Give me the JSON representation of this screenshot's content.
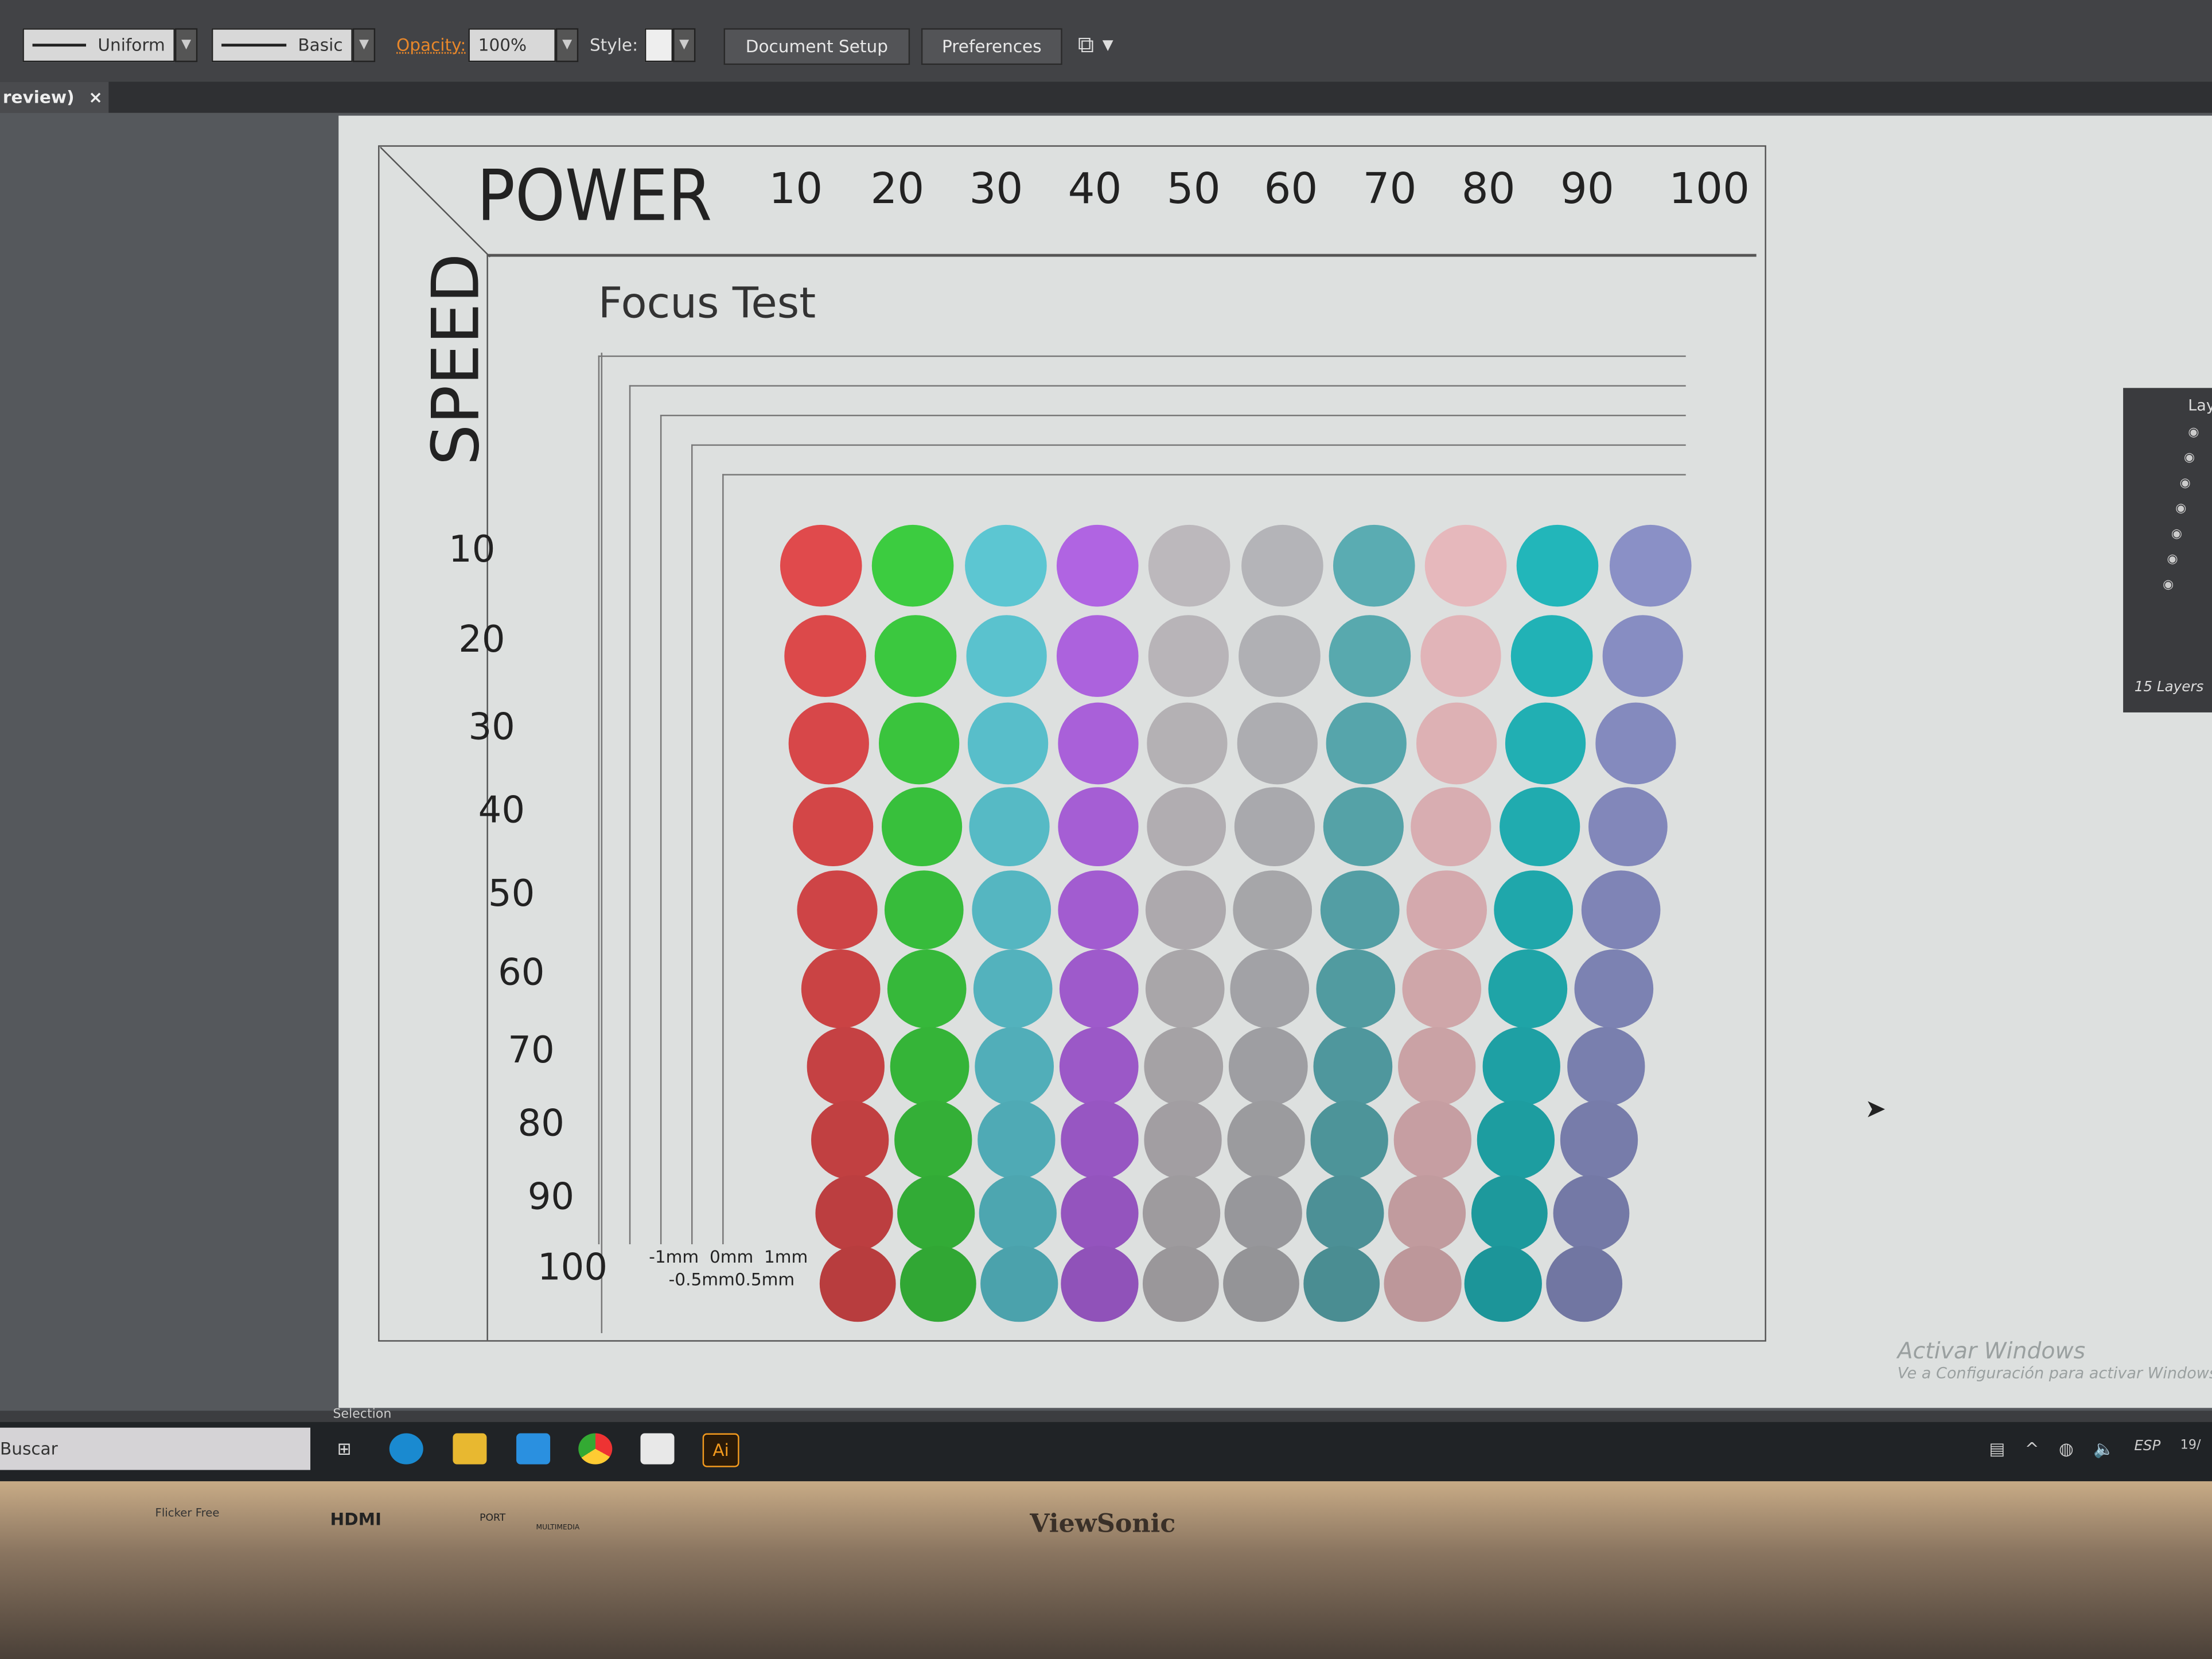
{
  "toolbar": {
    "stroke_profile": "Uniform",
    "brush": "Basic",
    "opacity_label": "Opacity:",
    "opacity_value": "100%",
    "style_label": "Style:",
    "document_setup": "Document Setup",
    "preferences": "Preferences",
    "accent": "#e8872a"
  },
  "tab": {
    "title": "review)",
    "close": "×"
  },
  "artwork": {
    "power_label": "POWER",
    "speed_label": "SPEED",
    "title": "Focus Test",
    "power_values": [
      "10",
      "20",
      "30",
      "40",
      "50",
      "60",
      "70",
      "80",
      "90",
      "100"
    ],
    "speed_values": [
      "10",
      "20",
      "30",
      "40",
      "50",
      "60",
      "70",
      "80",
      "90",
      "100"
    ],
    "focus_labels_top": [
      "-1mm",
      "0mm",
      "1mm"
    ],
    "focus_labels_bottom": [
      "-0.5mm",
      "0.5mm"
    ],
    "column_colors": [
      "#e04a4c",
      "#3ccc40",
      "#5cc6d2",
      "#b064e2",
      "#bcb8bc",
      "#b4b4b8",
      "#5aacb2",
      "#e6b8bc",
      "#22b6ba",
      "#8a90c6"
    ]
  },
  "layers_panel": {
    "tab": "Lay",
    "count": "15 Layers"
  },
  "status_bar": {
    "tool": "Selection"
  },
  "taskbar": {
    "search_placeholder": "Buscar",
    "apps": [
      "task-view-icon",
      "edge-icon",
      "file-explorer-icon",
      "mail-icon",
      "chrome-icon",
      "store-icon",
      "illustrator-icon"
    ],
    "illustrator_label": "Ai",
    "language": "ESP",
    "clock": "19/"
  },
  "watermark": {
    "title": "Activar Windows",
    "subtitle": "Ve a Configuración para activar Windows"
  },
  "monitor": {
    "brand": "ViewSonic",
    "hdmi": "HDMI",
    "port": "PORT",
    "flicker": "Flicker Free",
    "multimedia": "MULTIMEDIA"
  }
}
